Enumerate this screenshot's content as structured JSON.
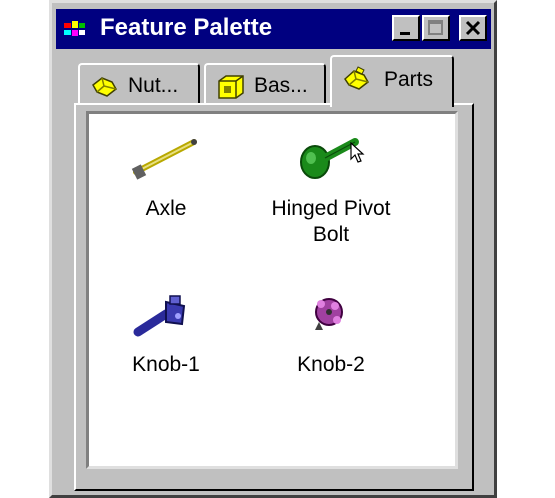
{
  "window": {
    "title": "Feature Palette",
    "controls": [
      "minimize",
      "maximize",
      "close"
    ]
  },
  "tabs": [
    {
      "label": "Nut...",
      "icon": "nut-icon",
      "active": false
    },
    {
      "label": "Bas...",
      "icon": "base-icon",
      "active": false
    },
    {
      "label": "Parts",
      "icon": "parts-icon",
      "active": true
    }
  ],
  "items": [
    {
      "label": "Axle",
      "icon": "axle-icon"
    },
    {
      "label": "Hinged Pivot Bolt",
      "icon": "hinged-pivot-bolt-icon"
    },
    {
      "label": "Knob-1",
      "icon": "knob-1-icon"
    },
    {
      "label": "Knob-2",
      "icon": "knob-2-icon"
    }
  ],
  "colors": {
    "titlebar": "#000080",
    "chrome": "#c0c0c0",
    "axle": "#b8a800",
    "hinged_bolt": "#1a8a1a",
    "knob1": "#2a2a9a",
    "knob2": "#a040a0"
  }
}
